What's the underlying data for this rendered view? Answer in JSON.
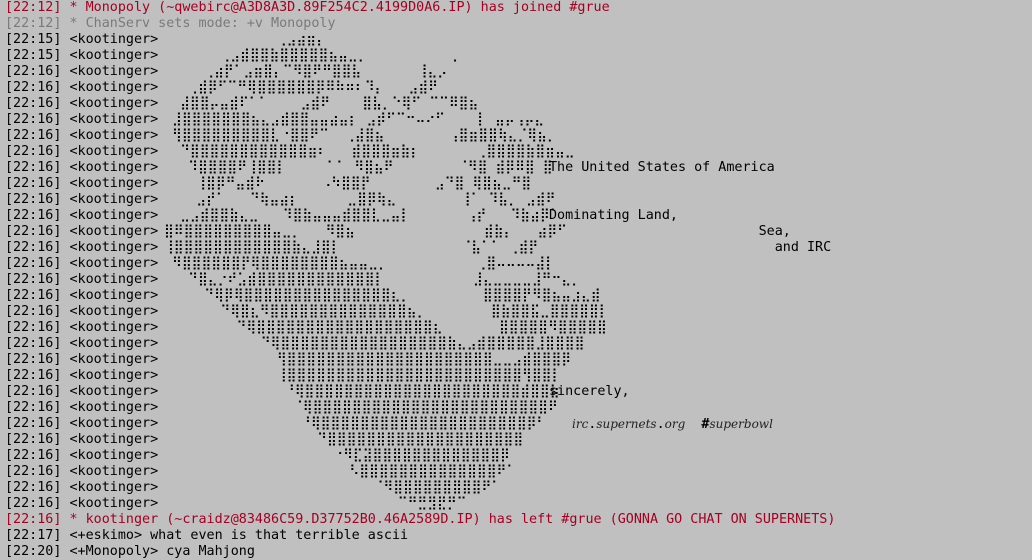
{
  "colors": {
    "background": "#c0c0c0",
    "event_join_part": "#a50021",
    "event_mode": "#7a7a7a",
    "text": "#000000"
  },
  "log": {
    "join_event": {
      "time": "[22:12]",
      "text": "* Monopoly (~qwebirc@A3D8A3D.89F254C2.4199D0A6.IP) has joined #grue"
    },
    "mode_event": {
      "time": "[22:12]",
      "text": "* ChanServ sets mode: +v Monopoly"
    },
    "art_lines": [
      {
        "time": "[22:15]",
        "nick": "<kootinger>",
        "art": "              ⢀⣠⣴⣶⡄",
        "side": ""
      },
      {
        "time": "[22:15]",
        "nick": "<kootinger>",
        "art": "       ⢀⣠⣾⣿⣿⣷⣿⣿⣿⣿⣿⣦⣤⣀⡀          ⢀",
        "side": ""
      },
      {
        "time": "[22:16]",
        "nick": "<kootinger>",
        "art": "     ⢀⣴⡟⠁⣠⣶⣿⡄⠉⠻⣿⠟⠛⣿⣿⣧       ⢸⣄⡠",
        "side": ""
      },
      {
        "time": "[22:16]",
        "nick": "<kootinger>",
        "art": "   ⢀⣾⡿⠋⠉⠛⢿⣿⣿⣿⣿⣿⣿⡿⠿⠷⠶⠆⠹⡄   ⣠⣾⠟",
        "side": ""
      },
      {
        "time": "[22:16]",
        "nick": "<kootinger>",
        "art": "  ⣼⣿⣿⡤⣤⣾⠏⠁⠁    ⣠⣾⠟    ⣿⣧⡀⠑⢿⠋ ⠉⠉⠿⣿⣦",
        "side": ""
      },
      {
        "time": "[22:16]",
        "nick": "<kootinger>",
        "art": " ⣸⣿⣿⣿⣿⣿⣿⣿⣦⣄⣠⣾⣿⣿⣤⣤⣴⣤⡆ ⣠⡾⠋⠉⠒⠤⠔⠋    ⡇ ⣤⡤⢠⡤⣄",
        "side": ""
      },
      {
        "time": "[22:16]",
        "nick": "<kootinger>",
        "art": " ⢻⣿⣿⣿⣿⣿⣿⣿⣿⣿⣇⠐⣿⣿⠟⠉  ⢀⣼⣿⣦        ⢠⣿⣶⣿⣿⢷⣄⡈⢿⣦⡀",
        "side": ""
      },
      {
        "time": "[22:16]",
        "nick": "<kootinger>",
        "art": "  ⠙⣿⣿⣿⣿⣿⣿⣿⣿⣿⣿⣿⣿⣶⠆   ⣾⣿⣿⣿⣶⣷⡆       ⢀⣿⣿⣿⣿⣷⣿⣶⣤⣀",
        "side": ""
      },
      {
        "time": "[22:16]",
        "nick": "<kootinger>",
        "art": "   ⠹⣿⣿⣿⣿⠟⢸⣿⣿⡇     ⠁⠁ ⠻⣿⣦⠟        ⠈⠻⣿ ⣾⡿⠿⣿ ⣿",
        "side": "The United States of America"
      },
      {
        "time": "[22:16]",
        "nick": "<kootinger>",
        "art": "    ⢸⣿⡿⠛⣤⣾⠗       ⠠⠳⣿⣿⡟        ⣠⠙⣿ ⢿⣿⣦⣀⠛⣿",
        "side": ""
      },
      {
        "time": "[22:16]",
        "nick": "<kootinger>",
        "art": "    ⣠⡞⠁   ⠙⢷⣤⣴⡆      ⣀⣿⡿⢷⣄        ⢸⠁ ⠹⣧⡀ ⣠⣾⠟",
        "side": ""
      },
      {
        "time": "[22:16]",
        "nick": "<kootinger>",
        "art": "  ⣀⣠⣾⣿⣿⣷⣄⣀   ⠹⣿⣷⣤⣤⣤⣾⣿⣿⣇⣀⣤⡇       ⢠⡞   ⠹⣷⣴⡿⠁",
        "side": "Dominating Land,"
      },
      {
        "time": "[22:16]",
        "nick": "<kootinger>",
        "art": "⣿⠿⣿⣿⣿⣿⣿⣿⣿⣿⣿⣤⣀⡀   ⠻⣿⣦                ⣾⣷⡄   ⣴⡿⠋",
        "side": "                          Sea,"
      },
      {
        "time": "[22:16]",
        "nick": "<kootinger>",
        "art": "⢸⣿⣿⣿⣿⣿⣿⣿⣿⣿⣿⣿⣿⣷⣄⣸⣿⡇               ⠈⣧⠁⠁ ⢀⣾⡟",
        "side": "                            and IRC"
      },
      {
        "time": "[22:16]",
        "nick": "<kootinger>",
        "art": " ⠻⣿⣿⣿⣿⣿⣿⡟⢿⣿⣿⣿⣿⣿⣿⣿⣿⣦⣤⣤⣀⡀           ⢀⣿⠤⠤⠤⠤⣼⡇",
        "side": ""
      },
      {
        "time": "[22:16]",
        "nick": "<kootinger>",
        "art": "   ⠙⣿⣄⡐⠞⣡⣾⣿⣿⣿⣿⣿⣿⣿⣿⣿⣿⣿⣿⡇           ⣸⣄⣀⣀⣀⣀⣸⠛⠒⣄⡀",
        "side": ""
      },
      {
        "time": "[22:16]",
        "nick": "<kootinger>",
        "art": "     ⠙⢿⡿⢿⣿⣿⣿⣿⣿⣿⣿⣿⣿⣿⣿⣿⣿⣿⣿⣆⡀         ⣿⣿⣿⣿⡟⠻⣿⣦⣤⣰⣄⣾",
        "side": ""
      },
      {
        "time": "[22:16]",
        "nick": "<kootinger>",
        "art": "       ⠙⢿⣿⣆⠻⣿⣿⣿⣿⣿⣿⣿⣿⣿⣿⣿⣿⣿⣿⣦⡀        ⣿⣷⣿⣿⣯⣀⣿⣿⣿⣿⣿⡇",
        "side": ""
      },
      {
        "time": "[22:16]",
        "nick": "<kootinger>",
        "art": "         ⠙⢿⣿⣿⣿⣿⣿⣿⣿⣿⣿⣿⣿⣿⣿⣿⣿⣿⣿⣿⣆       ⣿⣿⣿⣿⣿⠻⣿⣿⣿⣿⣿",
        "side": ""
      },
      {
        "time": "[22:16]",
        "nick": "<kootinger>",
        "art": "            ⠙⢿⣿⣿⣿⣿⣿⣿⣿⣿⣿⣿⣿⣿⣿⣿⣿⣿⣿⣷⣄⣠⣾⣿⣿⣿⣿⣿⣸⣿⣿⣿⣿",
        "side": ""
      },
      {
        "time": "[22:16]",
        "nick": "<kootinger>",
        "art": "              ⢻⣿⣿⣿⣿⣿⣿⣿⣿⣿⣿⣿⣿⣿⣿⣿⣿⣿⣿⣿⣿⣿⣀⣀⣠⣾⣿⣿⣿⡿",
        "side": ""
      },
      {
        "time": "[22:16]",
        "nick": "<kootinger>",
        "art": "              ⢸⣿⣿⣿⣿⣿⣿⣿⣿⣿⣿⣿⣿⣿⣿⣿⣿⣿⣿⣿⣿⣿⣿⣿⣿⢻⣿⣿⡇",
        "side": ""
      },
      {
        "time": "[22:16]",
        "nick": "<kootinger>",
        "art": "               ⠘⢿⣿⣿⣿⣿⣿⣿⣿⣿⣿⣿⣿⣿⣿⣿⣿⣿⣿⣿⣿⣿⣿⣿⣾⣿⣿⣷",
        "side": "sincerely,"
      },
      {
        "time": "[22:16]",
        "nick": "<kootinger>",
        "art": "                ⠈⢿⣿⣿⣿⣿⣿⣿⣿⣿⣿⣿⣿⣿⣿⣿⣿⣿⣿⣿⣿⣿⣿⣿⣿⣿⠟",
        "side": ""
      },
      {
        "time": "[22:16]",
        "nick": "<kootinger>",
        "art": "                 ⠘⢿⣿⣿⣿⣿⣿⣿⣿⣿⣿⣿⣿⣿⣿⣿⣿⣿⣿⣿⣿⣿⣿⡿⠃",
        "side": ""
      },
      {
        "time": "[22:16]",
        "nick": "<kootinger>",
        "art": "                   ⠙⣿⣿⣿⣿⣿⣿⣿⣿⣿⣿⣿⣿⣿⣿⣿⣿⣿⣿⣿⣿",
        "side": ""
      },
      {
        "time": "[22:16]",
        "nick": "<kootinger>",
        "art": "                     ⠐⠻⣏⣽⣿⣿⣿⣿⣿⣿⣿⣿⣿⣿⣿⣿⣿⡿",
        "side": ""
      },
      {
        "time": "[22:16]",
        "nick": "<kootinger>",
        "art": "                       ⠣⣿⣿⣿⣿⣿⣿⣿⣿⣿⣿⣿⣿⣿⣿⠟⠁",
        "side": ""
      },
      {
        "time": "[22:16]",
        "nick": "<kootinger>",
        "art": "                          ⠈⠻⣿⣿⣿⣿⣿⣿⣿⣿⣿⠟⠁",
        "side": ""
      },
      {
        "time": "[22:16]",
        "nick": "<kootinger>",
        "art": "                             ⠉⠛⣛⣻⣟⡛⠉",
        "side": ""
      }
    ],
    "signature": {
      "host": "irc",
      "dot1": ".",
      "domain": "supernets",
      "dot2": ".",
      "tld": "org",
      "channel_hash": "#",
      "channel": "superbowl"
    },
    "part_event": {
      "time": "[22:16]",
      "text": "* kootinger (~craidz@83486C59.D37752B0.46A2589D.IP) has left #grue (GONNA GO CHAT ON SUPERNETS)"
    },
    "messages": [
      {
        "time": "[22:17]",
        "nick": "<+eskimo>",
        "text": "what even is that terrible ascii"
      },
      {
        "time": "[22:20]",
        "nick": "<+Monopoly>",
        "text": "cya Mahjong"
      }
    ]
  }
}
